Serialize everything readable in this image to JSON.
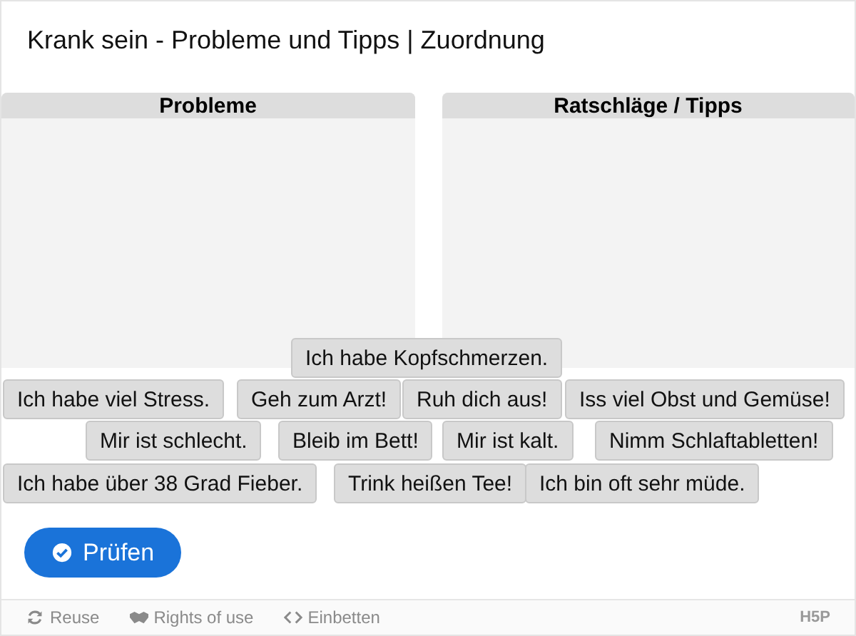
{
  "title": "Krank sein - Probleme und Tipps | Zuordnung",
  "drop_zones": [
    {
      "label": "Probleme"
    },
    {
      "label": "Ratschläge / Tipps"
    }
  ],
  "draggables": [
    "Ich habe Kopfschmerzen.",
    "Ich habe viel Stress.",
    "Geh zum Arzt!",
    "Ruh dich aus!",
    "Iss viel Obst und Gemüse!",
    "Mir ist schlecht.",
    "Bleib im Bett!",
    "Mir ist kalt.",
    "Nimm Schlaftabletten!",
    "Ich habe über 38 Grad Fieber.",
    "Trink heißen Tee!",
    "Ich bin oft sehr müde."
  ],
  "check_button": "Prüfen",
  "footer": {
    "links": [
      {
        "kind": "reuse",
        "label": "Reuse"
      },
      {
        "kind": "rights",
        "label": "Rights of use"
      },
      {
        "kind": "embed",
        "label": "Einbetten"
      }
    ],
    "logo": "H5P"
  }
}
